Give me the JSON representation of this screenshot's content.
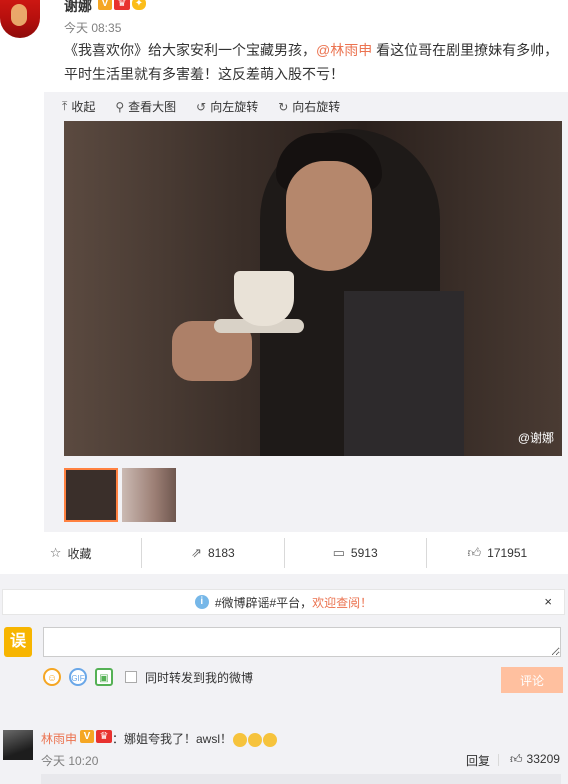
{
  "post": {
    "author": "谢娜",
    "time": "今天 08:35",
    "text_line1_pre": "《我喜欢你》给大家安利一个宝藏男孩，",
    "mention": "@林雨申",
    "text_line1_post": " 看这位哥在剧里撩妹有多帅，",
    "text_line2": "平时生活里就有多害羞！这反差萌入股不亏！"
  },
  "media_toolbar": {
    "collapse": "收起",
    "view_large": "查看大图",
    "rotate_left": "向左旋转",
    "rotate_right": "向右旋转"
  },
  "photo": {
    "watermark": "@谢娜"
  },
  "actions": {
    "favorite": "收藏",
    "repost_count": "8183",
    "comment_count": "5913",
    "like_count": "171951"
  },
  "notice": {
    "prefix": "#微博辟谣#平台，",
    "highlight": "欢迎查阅！",
    "close": "×"
  },
  "composer": {
    "avatar_label": "误",
    "input_value": "",
    "forward_label": "同时转发到我的微博",
    "submit": "评论"
  },
  "comment": {
    "author": "林雨申",
    "text": "：娜姐夸我了！awsl！",
    "time": "今天 10:20",
    "reply": "回复",
    "like_count": "33209"
  },
  "icons": {
    "collapse": "collapse-up-icon",
    "view_large": "magnifier-icon",
    "rotate_left": "rotate-left-icon",
    "rotate_right": "rotate-right-icon",
    "favorite": "star-icon",
    "repost": "share-icon",
    "comment": "comment-bubble-icon",
    "like": "thumbs-up-icon"
  },
  "colors": {
    "accent": "#eb7350",
    "submit_bg": "#ffc09f",
    "active_thumb": "#ff8140",
    "panel_bg": "#f2f2f5"
  }
}
